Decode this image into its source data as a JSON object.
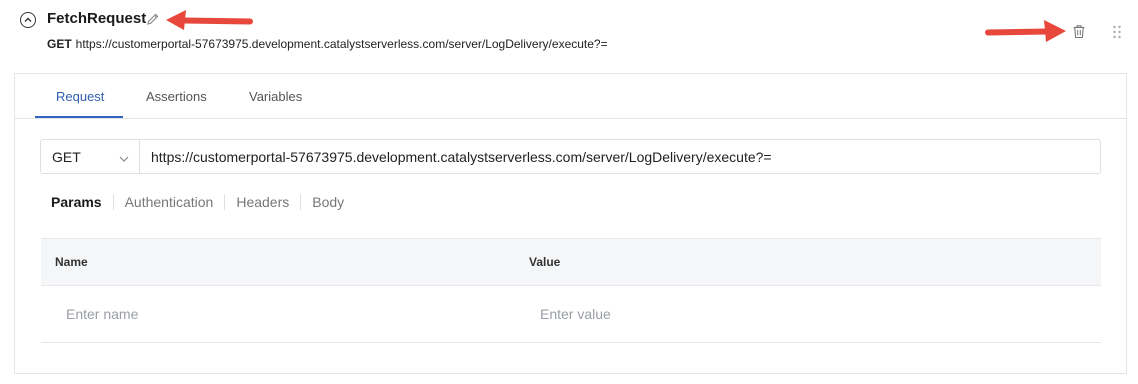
{
  "header": {
    "title": "FetchRequest",
    "method": "GET",
    "url": "https://customerportal-57673975.development.catalystserverless.com/server/LogDelivery/execute?="
  },
  "tabs": [
    {
      "label": "Request",
      "active": true
    },
    {
      "label": "Assertions",
      "active": false
    },
    {
      "label": "Variables",
      "active": false
    }
  ],
  "request": {
    "method": "GET",
    "url": "https://customerportal-57673975.development.catalystserverless.com/server/LogDelivery/execute?="
  },
  "subtabs": [
    {
      "label": "Params",
      "active": true
    },
    {
      "label": "Authentication",
      "active": false
    },
    {
      "label": "Headers",
      "active": false
    },
    {
      "label": "Body",
      "active": false
    }
  ],
  "params_table": {
    "columns": [
      "Name",
      "Value"
    ],
    "name_placeholder": "Enter name",
    "value_placeholder": "Enter value"
  },
  "colors": {
    "accent": "#2f63c0",
    "annotation_arrow": "#e8473c"
  },
  "icons": [
    "collapse-icon",
    "pencil-icon",
    "trash-icon",
    "drag-handle-icon",
    "chevron-down-icon"
  ]
}
